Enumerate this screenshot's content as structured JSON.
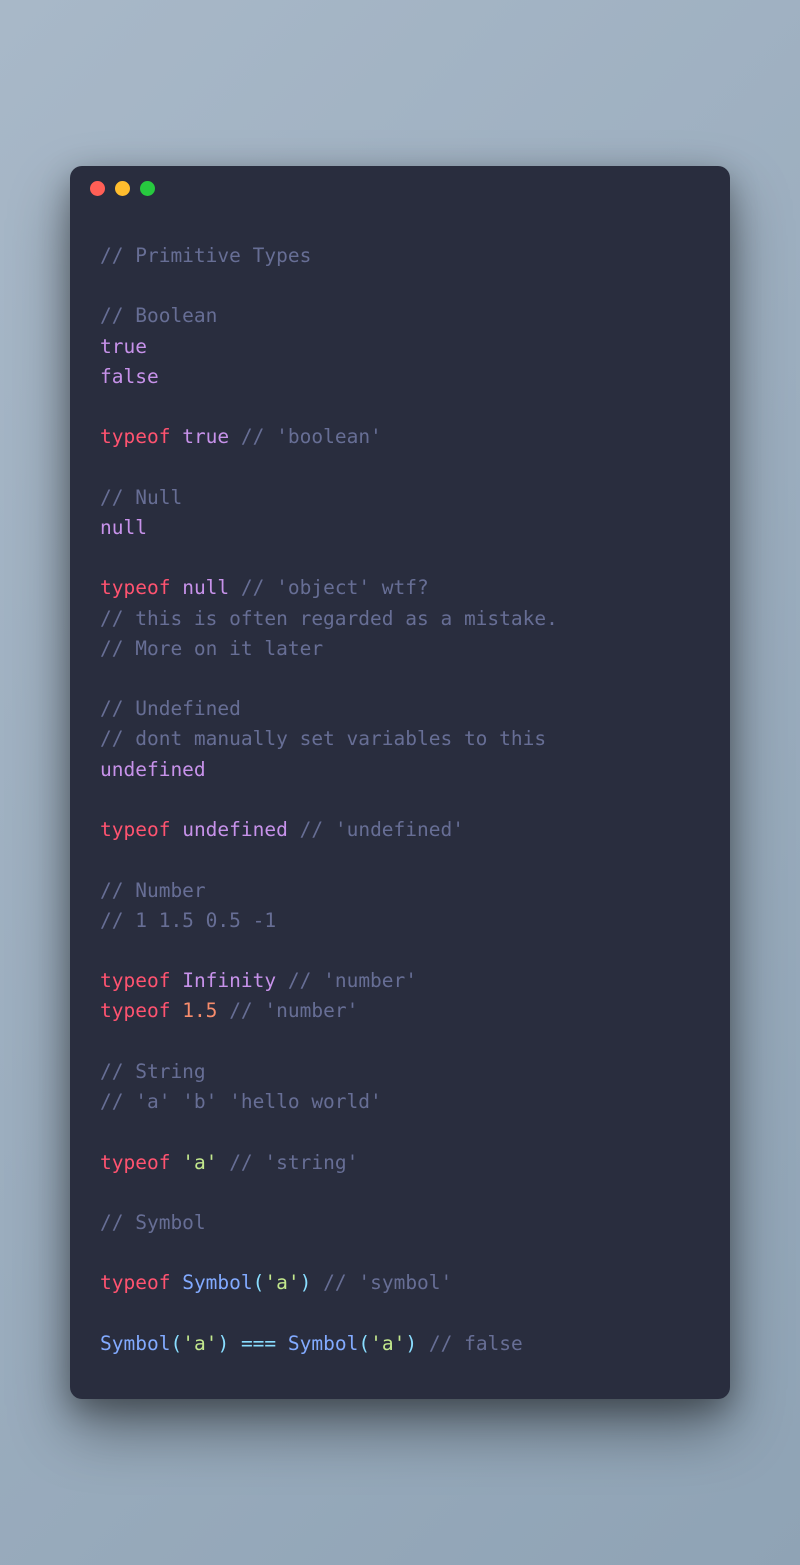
{
  "window": {
    "traffic_lights": [
      "close",
      "minimize",
      "maximize"
    ]
  },
  "code": {
    "line1": "// Primitive Types",
    "line2": "",
    "line3": "// Boolean",
    "line4_true": "true",
    "line5_false": "false",
    "line6": "",
    "line7_typeof": "typeof",
    "line7_true": "true",
    "line7_comment": "// 'boolean'",
    "line8": "",
    "line9": "// Null",
    "line10_null": "null",
    "line11": "",
    "line12_typeof": "typeof",
    "line12_null": "null",
    "line12_comment": "// 'object' wtf?",
    "line13": "// this is often regarded as a mistake.",
    "line14": "// More on it later",
    "line15": "",
    "line16": "// Undefined",
    "line17": "// dont manually set variables to this",
    "line18_undefined": "undefined",
    "line19": "",
    "line20_typeof": "typeof",
    "line20_undefined": "undefined",
    "line20_comment": "// 'undefined'",
    "line21": "",
    "line22": "// Number",
    "line23": "// 1 1.5 0.5 -1",
    "line24": "",
    "line25_typeof": "typeof",
    "line25_infinity": "Infinity",
    "line25_comment": "// 'number'",
    "line26_typeof": "typeof",
    "line26_num": "1.5",
    "line26_comment": "// 'number'",
    "line27": "",
    "line28": "// String",
    "line29": "// 'a' 'b' 'hello world'",
    "line30": "",
    "line31_typeof": "typeof",
    "line31_str": "'a'",
    "line31_comment": "// 'string'",
    "line32": "",
    "line33": "// Symbol",
    "line34": "",
    "line35_typeof": "typeof",
    "line35_symbol": "Symbol",
    "line35_lp": "(",
    "line35_arg": "'a'",
    "line35_rp": ")",
    "line35_comment": "// 'symbol'",
    "line36": "",
    "line37_symbol1": "Symbol",
    "line37_lp1": "(",
    "line37_arg1": "'a'",
    "line37_rp1": ")",
    "line37_eq": "===",
    "line37_symbol2": "Symbol",
    "line37_lp2": "(",
    "line37_arg2": "'a'",
    "line37_rp2": ")",
    "line37_comment": "// false"
  }
}
